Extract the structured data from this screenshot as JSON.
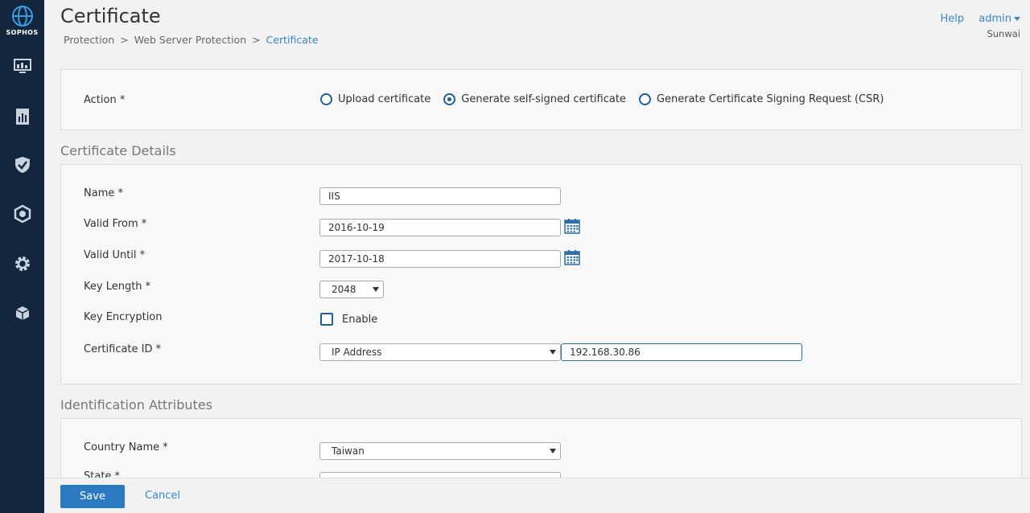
{
  "sidebar": {
    "brand": "SOPHOS",
    "items": [
      {
        "icon": "monitor-icon"
      },
      {
        "icon": "report-icon"
      },
      {
        "icon": "shield-check-icon"
      },
      {
        "icon": "protection-icon"
      },
      {
        "icon": "gear-icon"
      },
      {
        "icon": "box-icon"
      }
    ],
    "bg_color": "#12273d"
  },
  "header": {
    "title": "Certificate",
    "breadcrumb": [
      "Protection",
      "Web Server Protection",
      "Certificate"
    ],
    "breadcrumb_separator": ">",
    "help": "Help",
    "user": "admin",
    "org": "Sunwai"
  },
  "action": {
    "label": "Action *",
    "options": [
      {
        "label": "Upload certificate",
        "checked": false
      },
      {
        "label": "Generate self-signed certificate",
        "checked": true
      },
      {
        "label": "Generate Certificate Signing Request (CSR)",
        "checked": false
      }
    ]
  },
  "certificate_details": {
    "title": "Certificate Details",
    "name_label": "Name *",
    "name_value": "IIS",
    "valid_from_label": "Valid From *",
    "valid_from_value": "2016-10-19",
    "valid_until_label": "Valid Until *",
    "valid_until_value": "2017-10-18",
    "key_length_label": "Key Length *",
    "key_length_value": "2048",
    "key_encryption_label": "Key Encryption",
    "key_encryption_enable": "Enable",
    "key_encryption_checked": false,
    "certificate_id_label": "Certificate ID *",
    "certificate_id_type": "IP Address",
    "certificate_id_value": "192.168.30.86"
  },
  "identification": {
    "title": "Identification Attributes",
    "country_label": "Country Name *",
    "country_value": "Taiwan",
    "state_label": "State *"
  },
  "footer": {
    "save": "Save",
    "cancel": "Cancel"
  },
  "colors": {
    "accent": "#2a7ac2",
    "link": "#3a86c8",
    "radio": "#1d5e9c"
  }
}
